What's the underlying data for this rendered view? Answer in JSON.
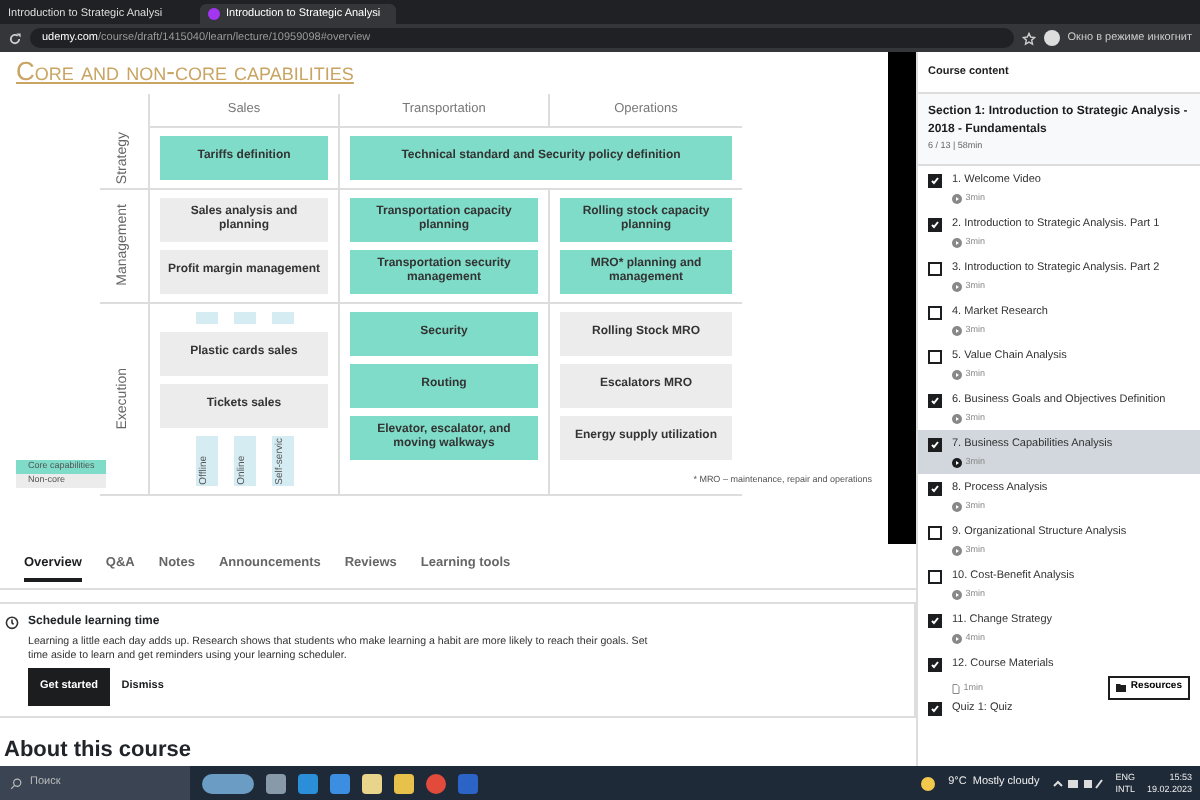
{
  "browser": {
    "tabs": [
      {
        "title": "Introduction to Strategic Analysi",
        "selected": false
      },
      {
        "title": "Introduction to Strategic Analysi",
        "selected": true
      }
    ],
    "address": "udemy.com",
    "address_path": "/course/draft/1415040/learn/lecture/10959098#overview",
    "profile": "Окно в режиме инкогнит"
  },
  "slide": {
    "title": "Core and non-core capabilities",
    "columns": [
      "Sales",
      "Transportation",
      "Operations"
    ],
    "rows": [
      {
        "label": "Strategy",
        "groups": [
          {
            "wide": false,
            "cells": [
              {
                "text": "Tariffs definition",
                "kind": "core"
              }
            ]
          },
          {
            "wide": true,
            "cells": [
              {
                "text": "Technical standard and Security policy definition",
                "kind": "core"
              }
            ]
          }
        ]
      },
      {
        "label": "Management",
        "groups": [
          {
            "wide": false,
            "cells": [
              {
                "text": "Sales analysis and planning",
                "kind": "noncore"
              },
              {
                "text": "Profit margin management",
                "kind": "noncore"
              }
            ]
          },
          {
            "wide": false,
            "cells": [
              {
                "text": "Transportation capacity planning",
                "kind": "core"
              },
              {
                "text": "Transportation security management",
                "kind": "core"
              }
            ]
          },
          {
            "wide": false,
            "cells": [
              {
                "text": "Rolling stock capacity planning",
                "kind": "core"
              },
              {
                "text": "MRO* planning and management",
                "kind": "core"
              }
            ]
          }
        ]
      },
      {
        "label": "Execution",
        "groups": [
          {
            "wide": false,
            "channels": [
              "Offline",
              "Online",
              "Self-servic"
            ],
            "cells": [
              {
                "text": "Plastic cards sales",
                "kind": "noncore"
              },
              {
                "text": "Tickets sales",
                "kind": "noncore"
              }
            ]
          },
          {
            "wide": false,
            "cells": [
              {
                "text": "Security",
                "kind": "core"
              },
              {
                "text": "Routing",
                "kind": "core"
              },
              {
                "text": "Elevator, escalator, and moving walkways",
                "kind": "core"
              }
            ]
          },
          {
            "wide": false,
            "cells": [
              {
                "text": "Rolling Stock MRO",
                "kind": "noncore"
              },
              {
                "text": "Escalators MRO",
                "kind": "noncore"
              },
              {
                "text": "Energy supply utilization",
                "kind": "noncore"
              }
            ]
          }
        ]
      }
    ],
    "legend": [
      {
        "label": "Core capabilities",
        "kind": "core"
      },
      {
        "label": "Non-core",
        "kind": "noncore"
      }
    ],
    "footnote": "* MRO – maintenance, repair and operations"
  },
  "course_tabs": [
    {
      "label": "Overview",
      "selected": true
    },
    {
      "label": "Q&A",
      "selected": false
    },
    {
      "label": "Notes",
      "selected": false
    },
    {
      "label": "Announcements",
      "selected": false
    },
    {
      "label": "Reviews",
      "selected": false
    },
    {
      "label": "Learning tools",
      "selected": false
    }
  ],
  "reminder": {
    "title": "Schedule learning time",
    "text": "Learning a little each day adds up. Research shows that students who make learning a habit are more likely to reach their goals. Set time aside to learn and get reminders using your learning scheduler.",
    "primary_button": "Get started",
    "secondary_button": "Dismiss"
  },
  "about_heading": "About this course",
  "sidebar": {
    "title": "Course content",
    "section_title": "Section 1: Introduction to Strategic Analysis - 2018 - Fundamentals",
    "section_meta": "6 / 13 | 58min",
    "items": [
      {
        "title": "1. Welcome Video",
        "duration": "3min",
        "kind": "video",
        "checked": true,
        "selected": false
      },
      {
        "title": "2. Introduction to Strategic Analysis. Part 1",
        "duration": "3min",
        "kind": "video",
        "checked": true,
        "selected": false
      },
      {
        "title": "3. Introduction to Strategic Analysis. Part 2",
        "duration": "3min",
        "kind": "video",
        "checked": false,
        "selected": false
      },
      {
        "title": "4. Market Research",
        "duration": "3min",
        "kind": "video",
        "checked": false,
        "selected": false
      },
      {
        "title": "5. Value Chain Analysis",
        "duration": "3min",
        "kind": "video",
        "checked": false,
        "selected": false
      },
      {
        "title": "6. Business Goals and Objectives Definition",
        "duration": "3min",
        "kind": "video",
        "checked": true,
        "selected": false
      },
      {
        "title": "7. Business Capabilities Analysis",
        "duration": "3min",
        "kind": "video",
        "checked": true,
        "selected": true
      },
      {
        "title": "8. Process Analysis",
        "duration": "3min",
        "kind": "video",
        "checked": true,
        "selected": false
      },
      {
        "title": "9. Organizational Structure Analysis",
        "duration": "3min",
        "kind": "video",
        "checked": false,
        "selected": false
      },
      {
        "title": "10. Cost-Benefit Analysis",
        "duration": "3min",
        "kind": "video",
        "checked": false,
        "selected": false
      },
      {
        "title": "11. Change Strategy",
        "duration": "4min",
        "kind": "video",
        "checked": true,
        "selected": false
      },
      {
        "title": "12. Course Materials",
        "duration": "1min",
        "kind": "document",
        "resources": "Resources",
        "checked": true,
        "selected": false
      },
      {
        "title": "Quiz 1: Quiz",
        "kind": "quiz",
        "checked": true,
        "selected": false
      }
    ]
  },
  "taskbar": {
    "search_placeholder": "Поиск",
    "weather": "9°C  Mostly cloudy",
    "language": "ENG",
    "layout": "INTL",
    "time": "15:53",
    "date": "19.02.2023"
  }
}
